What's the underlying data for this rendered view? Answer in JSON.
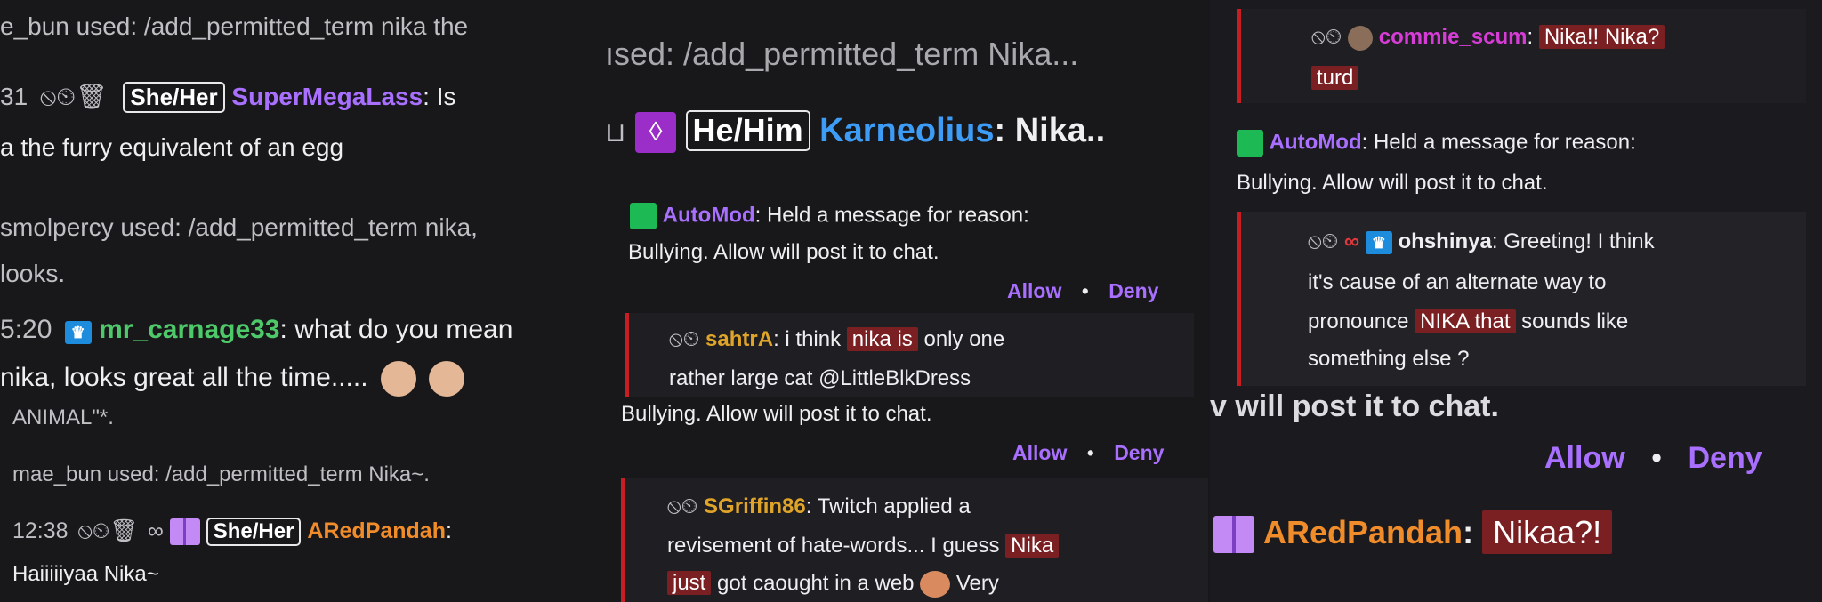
{
  "panel1": {
    "line1": "e_bun used: /add_permitted_term nika the",
    "m1_time": "31",
    "m1_icons": "⦸⏲🗑",
    "m1_pronoun": "She/Her",
    "m1_user": "SuperMegaLass",
    "m1_text_a": ": Is",
    "m1_text_b": "a the furry equivalent of an egg",
    "mod2_a": "smolpercy used: /add_permitted_term nika,",
    "mod2_b": "looks.",
    "m3_time": "5:20",
    "m3_user": "mr_carnage33",
    "m3_text_a": ": what do you mean",
    "m3_text_b": "nika, looks great all the time.....",
    "small1": "ANIMAL\"*.",
    "small2": "mae_bun used: /add_permitted_term Nika~.",
    "m4_time": "12:38",
    "m4_pronoun": "She/Her",
    "m4_user": "ARedPandah",
    "m4_colon": ":",
    "m4_text": "Haiiiiiyaa Nika~"
  },
  "panel2": {
    "top": "ısed: /add_permitted_term Nika...",
    "pronoun": "He/Him",
    "user": "Karneolius",
    "text": ": Nika..",
    "automod_name": "AutoMod",
    "automod_text_a": ": Held a message for reason:",
    "automod_text_b": "Bullying. Allow will post it to chat.",
    "allow": "Allow",
    "dot": "•",
    "deny": "Deny",
    "h1_user": "sahtrA",
    "h1_text_a": ": i think",
    "h1_hl": "nika is",
    "h1_text_b": "only one",
    "h1_text_c": "rather large cat @LittleBlkDress",
    "bullying2": "Bullying. Allow will post it to chat.",
    "allow2": "Allow",
    "deny2": "Deny",
    "h2_user": "SGriffin86",
    "h2_text_a": ": Twitch applied a",
    "h2_text_b": "revisement of hate-words... I guess",
    "h2_hl1": "Nika",
    "h2_hl2": "just",
    "h2_text_c": "got caought in a web",
    "h2_text_d": "Very"
  },
  "panel3": {
    "h1_user": "commie_scum",
    "h1_colon": ":",
    "h1_hl1": "Nika!! Nika?",
    "h1_hl2": "turd",
    "automod_name": "AutoMod",
    "automod_text_a": ": Held a message for reason:",
    "automod_text_b": "Bullying. Allow will post it to chat.",
    "h2_user": "ohshinya",
    "h2_text_a": ": Greeting! I think",
    "h2_text_b": "it's cause of an alternate way to",
    "h2_text_c": "pronounce",
    "h2_hl": "NIKA that",
    "h2_text_d": "sounds like",
    "h2_text_e": "something else ?",
    "partial": "v will post it to chat.",
    "allow": "Allow",
    "dot": "•",
    "deny": "Deny",
    "last_user": "ARedPandah",
    "last_colon": ":",
    "last_hl": "Nikaa?!"
  },
  "colors": {
    "background": "#18181b",
    "highlight": "#7a1f22",
    "twitch_purple": "#a970ff",
    "held_bar": "#c71e23"
  }
}
